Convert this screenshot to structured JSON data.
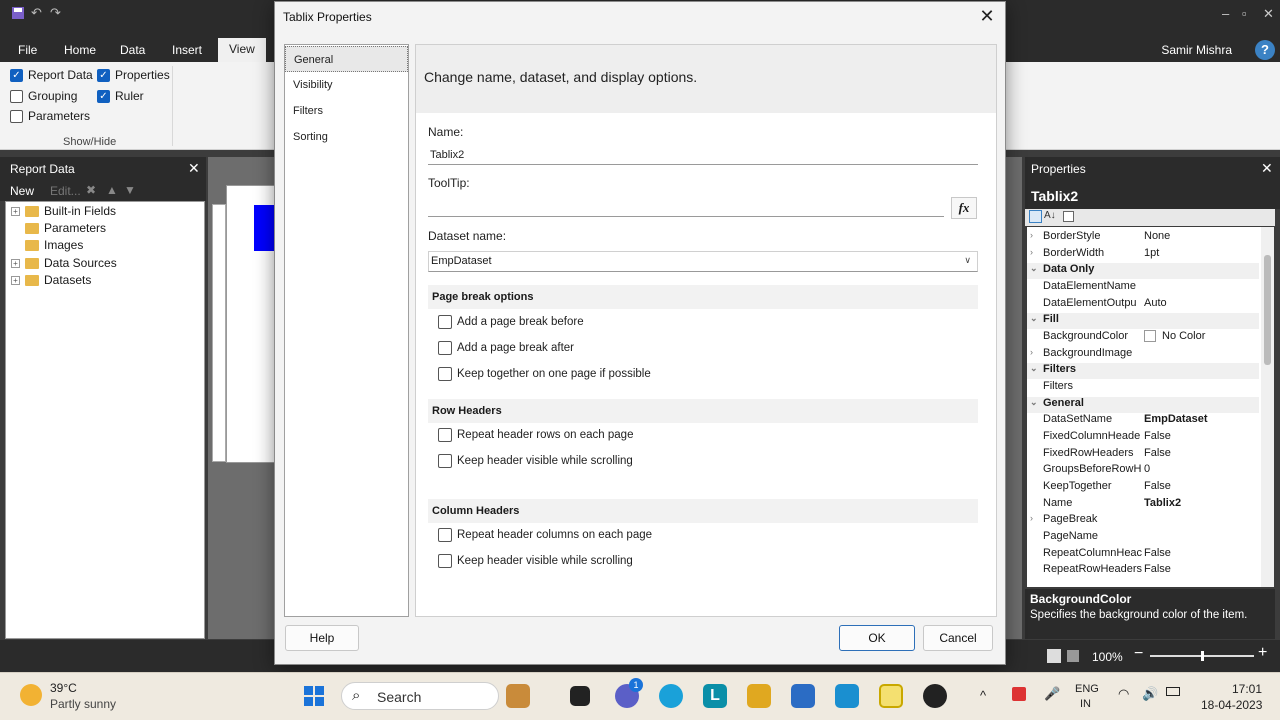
{
  "ribbon": {
    "tabs": [
      "File",
      "Home",
      "Data",
      "Insert",
      "View"
    ],
    "active_tab": "View",
    "user_name": "Samir Mishra",
    "checkboxes": [
      {
        "label": "Report Data",
        "checked": true
      },
      {
        "label": "Properties",
        "checked": true
      },
      {
        "label": "Grouping",
        "checked": false
      },
      {
        "label": "Ruler",
        "checked": true
      },
      {
        "label": "Parameters",
        "checked": false
      }
    ],
    "group_label": "Show/Hide"
  },
  "report_data": {
    "title": "Report Data",
    "toolbar": {
      "new_label": "New",
      "edit_label": "Edit..."
    },
    "tree": [
      {
        "label": "Built-in Fields",
        "expandable": true
      },
      {
        "label": "Parameters",
        "expandable": false
      },
      {
        "label": "Images",
        "expandable": false
      },
      {
        "label": "Data Sources",
        "expandable": true
      },
      {
        "label": "Datasets",
        "expandable": true
      }
    ]
  },
  "dialog": {
    "title": "Tablix Properties",
    "nav": [
      "General",
      "Visibility",
      "Filters",
      "Sorting"
    ],
    "selected_nav": "General",
    "header": "Change name, dataset, and display options.",
    "name_label": "Name:",
    "name_value": "Tablix2",
    "tooltip_label": "ToolTip:",
    "tooltip_value": "",
    "fx_label": "fx",
    "dataset_label": "Dataset name:",
    "dataset_value": "EmpDataset",
    "page_break_section": "Page break options",
    "page_break_options": [
      {
        "label": "Add a page break before",
        "checked": false
      },
      {
        "label": "Add a page break after",
        "checked": false
      },
      {
        "label": "Keep together on one page if possible",
        "checked": false
      }
    ],
    "row_headers_section": "Row Headers",
    "row_header_options": [
      {
        "label": "Repeat header rows on each page",
        "checked": false
      },
      {
        "label": "Keep header visible while scrolling",
        "checked": false
      }
    ],
    "column_headers_section": "Column Headers",
    "column_header_options": [
      {
        "label": "Repeat header columns on each page",
        "checked": false
      },
      {
        "label": "Keep header visible while scrolling",
        "checked": false
      }
    ],
    "help_label": "Help",
    "ok_label": "OK",
    "cancel_label": "Cancel"
  },
  "properties": {
    "title": "Properties",
    "object_name": "Tablix2",
    "rows": [
      {
        "name": "BorderStyle",
        "value": "None",
        "expand": true
      },
      {
        "name": "BorderWidth",
        "value": "1pt",
        "expand": true
      },
      {
        "name": "Data Only",
        "category": true
      },
      {
        "name": "DataElementName",
        "value": ""
      },
      {
        "name": "DataElementOutpu",
        "value": "Auto"
      },
      {
        "name": "Fill",
        "category": true
      },
      {
        "name": "BackgroundColor",
        "value": "No Color",
        "swatch": true
      },
      {
        "name": "BackgroundImage",
        "value": "",
        "expand": true
      },
      {
        "name": "Filters",
        "category": true
      },
      {
        "name": "Filters",
        "value": ""
      },
      {
        "name": "General",
        "category": true
      },
      {
        "name": "DataSetName",
        "value": "EmpDataset",
        "bold": true
      },
      {
        "name": "FixedColumnHeade",
        "value": "False"
      },
      {
        "name": "FixedRowHeaders",
        "value": "False"
      },
      {
        "name": "GroupsBeforeRowH",
        "value": "0"
      },
      {
        "name": "KeepTogether",
        "value": "False"
      },
      {
        "name": "Name",
        "value": "Tablix2",
        "bold": true
      },
      {
        "name": "PageBreak",
        "value": "",
        "expand": true
      },
      {
        "name": "PageName",
        "value": ""
      },
      {
        "name": "RepeatColumnHeac",
        "value": "False"
      },
      {
        "name": "RepeatRowHeaders",
        "value": "False"
      }
    ],
    "desc_title": "BackgroundColor",
    "desc_text": "Specifies the background color of the item."
  },
  "status": {
    "zoom": "100%"
  },
  "taskbar": {
    "temperature": "39°C",
    "weather": "Partly sunny",
    "search_placeholder": "Search",
    "chat_badge": "1",
    "language": "ENG",
    "region": "IN",
    "time": "17:01",
    "date": "18-04-2023"
  },
  "colors": {
    "accent": "#1060c0",
    "dark_chrome": "#2b2b2b"
  }
}
